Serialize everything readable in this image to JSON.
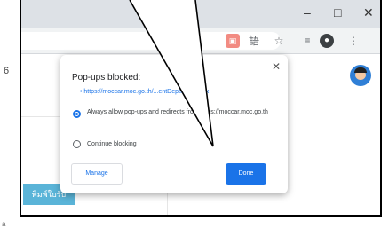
{
  "left_margin": {
    "number": "6",
    "mark": "a"
  },
  "window": {
    "minimize": "–",
    "maximize": "□",
    "close": "✕"
  },
  "toolbar": {
    "popup_indicator": "▣",
    "translate": "語",
    "star": "☆",
    "reading_list": "≡",
    "avatar": "●",
    "menu": "⋮"
  },
  "page": {
    "button_label": "พิมพ์ใบรับ"
  },
  "dialog": {
    "close": "✕",
    "title": "Pop-ups blocked:",
    "link": "• https://moccar.moc.go.th/...entDeptInput.aspx",
    "option_allow": "Always allow pop-ups and redirects from https://moccar.moc.go.th",
    "option_block": "Continue blocking",
    "manage_label": "Manage",
    "done_label": "Done"
  }
}
